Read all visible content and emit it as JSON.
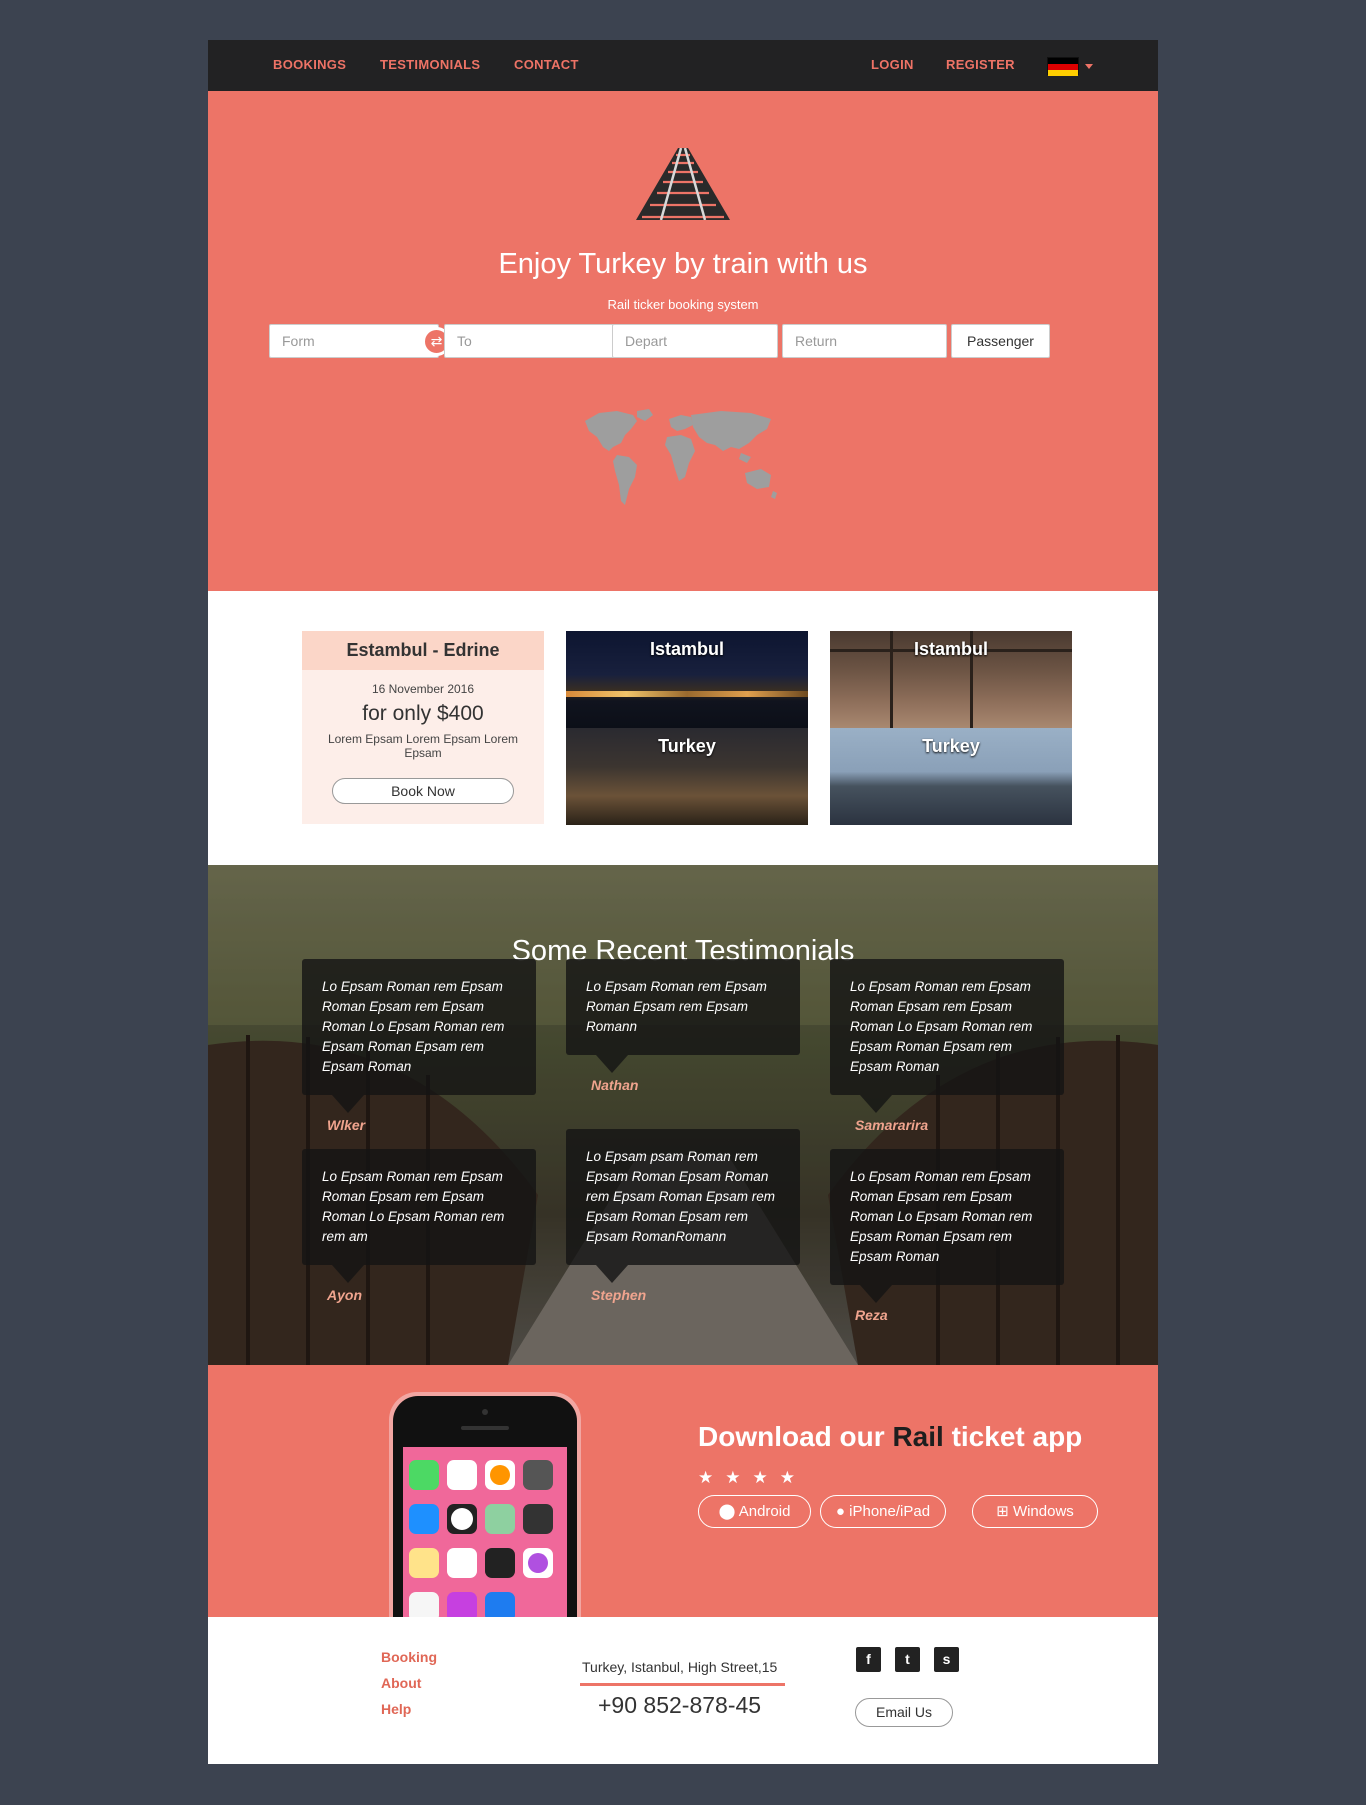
{
  "nav": {
    "left_items": [
      "BOOKINGS",
      "TESTIMONIALS",
      "CONTACT"
    ],
    "login": "LOGIN",
    "register": "REGISTER",
    "language_flag": "german-flag-icon"
  },
  "hero": {
    "title": "Enjoy Turkey by train with us",
    "subtitle": "Rail ticker booking system",
    "from_placeholder": "Form",
    "to_placeholder": "To",
    "depart_placeholder": "Depart",
    "return_placeholder": "Return",
    "passenger_label": "Passenger"
  },
  "offer": {
    "route": "Estambul - Edrine",
    "date": "16 November 2016",
    "price": "for only $400",
    "description": "Lorem Epsam Lorem Epsam Lorem Epsam",
    "book_label": "Book Now"
  },
  "destinations": [
    {
      "top": "Istambul",
      "bottom": "Turkey"
    },
    {
      "top": "Istambul",
      "bottom": "Turkey"
    }
  ],
  "testimonials": {
    "title": "Some Recent Testimonials",
    "items": [
      {
        "text": "Lo Epsam Roman rem Epsam Roman Epsam rem Epsam Roman Lo Epsam Roman rem Epsam Roman Epsam rem Epsam Roman",
        "author": "Wlker"
      },
      {
        "text": "Lo Epsam Roman rem Epsam Roman Epsam rem Epsam Romann",
        "author": "Nathan"
      },
      {
        "text": "Lo Epsam Roman rem Epsam Roman Epsam rem Epsam Roman Lo Epsam Roman rem Epsam Roman Epsam rem Epsam Roman",
        "author": "Samararira"
      },
      {
        "text": "Lo Epsam Roman rem Epsam Roman Epsam rem Epsam Roman Lo Epsam Roman rem rem am",
        "author": "Ayon"
      },
      {
        "text": "Lo Epsam psam Roman rem Epsam Roman Epsam Roman rem Epsam Roman Epsam rem Epsam Roman Epsam rem Epsam RomanRomann",
        "author": "Stephen"
      },
      {
        "text": "Lo Epsam Roman rem Epsam Roman Epsam rem Epsam Roman Lo Epsam Roman rem Epsam Roman Epsam rem Epsam Roman",
        "author": "Reza"
      }
    ]
  },
  "app": {
    "title_prefix": "Download our ",
    "title_highlight": "Rail",
    "title_suffix": " ticket app",
    "rating_stars": "★★★★",
    "stores": [
      "Android",
      "iPhone/iPad",
      "Windows"
    ]
  },
  "footer": {
    "links": [
      "Booking",
      "About",
      "Help"
    ],
    "address": "Turkey, Istanbul, High Street,15",
    "phone": "+90 852-878-45",
    "social": [
      "facebook-icon",
      "twitter-icon",
      "skype-icon"
    ],
    "email_label": "Email Us"
  },
  "colors": {
    "accent": "#ed7467",
    "dark": "#222223",
    "background": "#3c4350"
  }
}
